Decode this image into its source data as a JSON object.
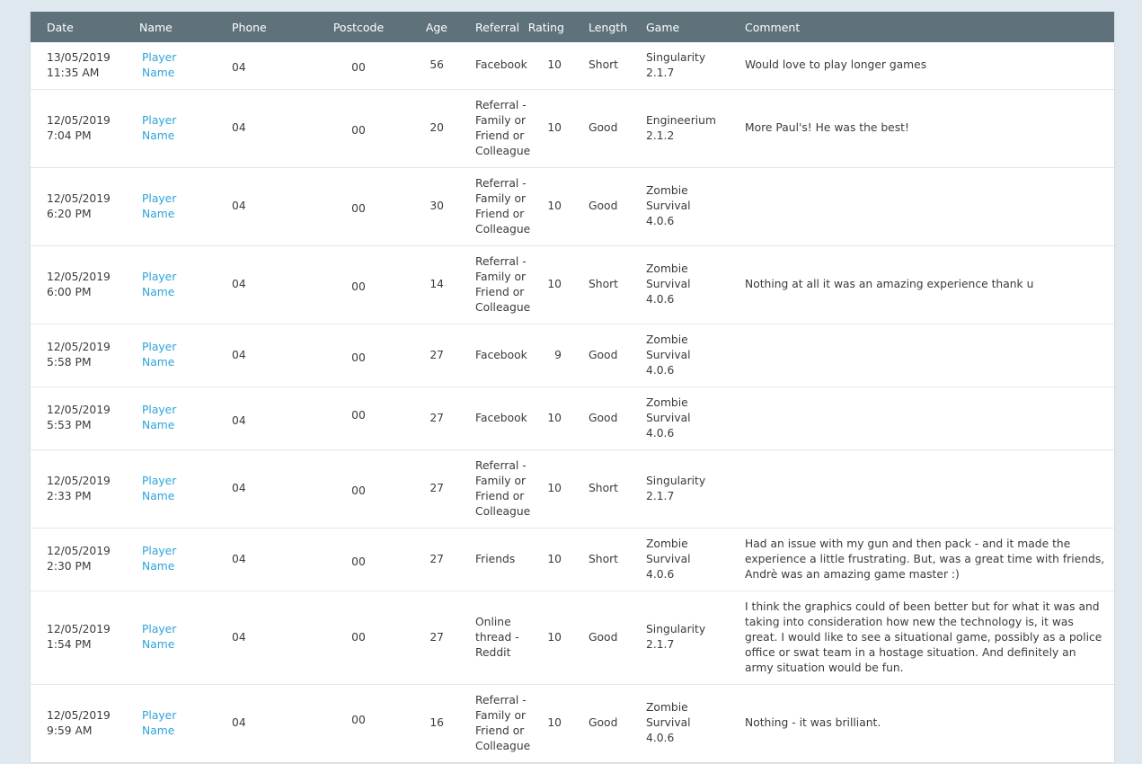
{
  "table": {
    "headers": [
      "Date",
      "Name",
      "Phone",
      "Postcode",
      "Age",
      "Referral",
      "Rating",
      "Length",
      "Game",
      "Comment"
    ],
    "rows": [
      {
        "date": "13/05/2019",
        "time": "11:35 AM",
        "name1": "Player",
        "name2": "Name",
        "phone": "04",
        "postcode": "00",
        "age": "56",
        "referral": [
          "Facebook"
        ],
        "rating": "10",
        "length": "Short",
        "game": [
          "Singularity",
          "2.1.7"
        ],
        "comment": "Would love to play longer games"
      },
      {
        "date": "12/05/2019",
        "time": "7:04 PM",
        "name1": "Player",
        "name2": "Name",
        "phone": "04",
        "postcode": "00",
        "age": "20",
        "referral": [
          "Referral -",
          "Family or",
          "Friend or",
          "Colleague"
        ],
        "rating": "10",
        "length": "Good",
        "game": [
          "Engineerium",
          "2.1.2"
        ],
        "comment": "More Paul's! He was the best!"
      },
      {
        "date": "12/05/2019",
        "time": "6:20 PM",
        "name1": "Player",
        "name2": "Name",
        "phone": "04",
        "postcode": "00",
        "age": "30",
        "referral": [
          "Referral -",
          "Family or",
          "Friend or",
          "Colleague"
        ],
        "rating": "10",
        "length": "Good",
        "game": [
          "Zombie",
          "Survival",
          "4.0.6"
        ],
        "comment": ""
      },
      {
        "date": "12/05/2019",
        "time": "6:00 PM",
        "name1": "Player",
        "name2": "Name",
        "phone": "04",
        "postcode": "00",
        "age": "14",
        "referral": [
          "Referral -",
          "Family or",
          "Friend or",
          "Colleague"
        ],
        "rating": "10",
        "length": "Short",
        "game": [
          "Zombie",
          "Survival",
          "4.0.6"
        ],
        "comment": "Nothing at all it was an amazing experience thank u"
      },
      {
        "date": "12/05/2019",
        "time": "5:58 PM",
        "name1": "Player",
        "name2": "Name",
        "phone": "04",
        "postcode": "00",
        "age": "27",
        "referral": [
          "Facebook"
        ],
        "rating": "9",
        "length": "Good",
        "game": [
          "Zombie",
          "Survival",
          "4.0.6"
        ],
        "comment": ""
      },
      {
        "date": "12/05/2019",
        "time": "5:53 PM",
        "name1": "Player",
        "name2": "Name",
        "phone": "04",
        "postcode": "00",
        "age": "27",
        "referral": [
          "Facebook"
        ],
        "rating": "10",
        "length": "Good",
        "game": [
          "Zombie",
          "Survival",
          "4.0.6"
        ],
        "comment": ""
      },
      {
        "date": "12/05/2019",
        "time": "2:33 PM",
        "name1": "Player",
        "name2": "Name",
        "phone": "04",
        "postcode": "00",
        "age": "27",
        "referral": [
          "Referral -",
          "Family or",
          "Friend or",
          "Colleague"
        ],
        "rating": "10",
        "length": "Short",
        "game": [
          "Singularity",
          "2.1.7"
        ],
        "comment": ""
      },
      {
        "date": "12/05/2019",
        "time": "2:30 PM",
        "name1": "Player",
        "name2": "Name",
        "phone": "04",
        "postcode": "00",
        "age": "27",
        "referral": [
          "Friends"
        ],
        "rating": "10",
        "length": "Short",
        "game": [
          "Zombie",
          "Survival",
          "4.0.6"
        ],
        "comment": "Had an issue with my gun and then pack - and it made the experience a little frustrating. But, was a great time with friends, Andrè was an amazing game master :)"
      },
      {
        "date": "12/05/2019",
        "time": "1:54 PM",
        "name1": "Player",
        "name2": "Name",
        "phone": "04",
        "postcode": "00",
        "age": "27",
        "referral": [
          "Online",
          "thread -",
          "Reddit"
        ],
        "rating": "10",
        "length": "Good",
        "game": [
          "Singularity",
          "2.1.7"
        ],
        "comment": "I think the graphics could of been better but for what it was and taking into consideration how new the technology is, it was great. I would like to see a situational game, possibly as a police office or swat team in a hostage situation. And definitely an army situation would be fun."
      },
      {
        "date": "12/05/2019",
        "time": "9:59 AM",
        "name1": "Player",
        "name2": "Name",
        "phone": "04",
        "postcode": "00",
        "age": "16",
        "referral": [
          "Referral -",
          "Family or",
          "Friend or",
          "Colleague"
        ],
        "rating": "10",
        "length": "Good",
        "game": [
          "Zombie",
          "Survival",
          "4.0.6"
        ],
        "comment": "Nothing - it was brilliant."
      }
    ]
  }
}
